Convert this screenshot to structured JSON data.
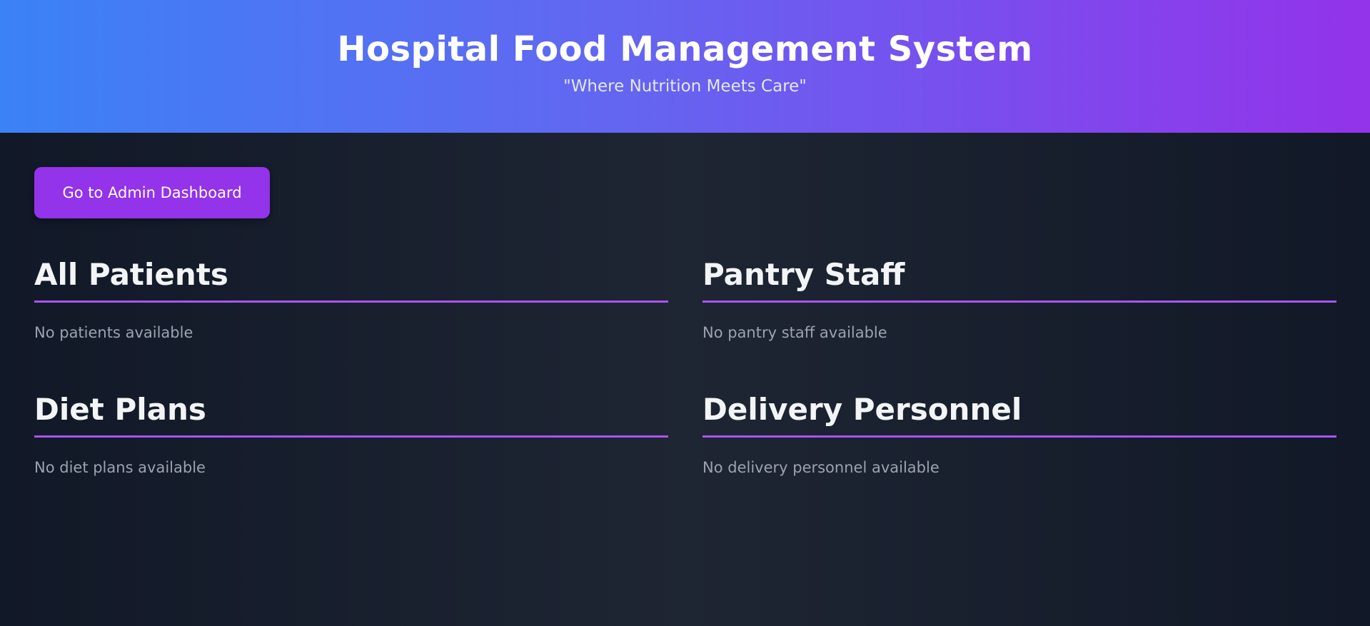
{
  "header": {
    "title": "Hospital Food Management System",
    "tagline": "\"Where Nutrition Meets Care\""
  },
  "actions": {
    "admin_button_label": "Go to Admin Dashboard"
  },
  "sections": [
    {
      "title": "All Patients",
      "empty_message": "No patients available"
    },
    {
      "title": "Pantry Staff",
      "empty_message": "No pantry staff available"
    },
    {
      "title": "Diet Plans",
      "empty_message": "No diet plans available"
    },
    {
      "title": "Delivery Personnel",
      "empty_message": "No delivery personnel available"
    }
  ],
  "colors": {
    "header_gradient_start": "#3b82f6",
    "header_gradient_end": "#9333ea",
    "button": "#9333ea",
    "divider": "#a855f7",
    "background": "#111827"
  }
}
